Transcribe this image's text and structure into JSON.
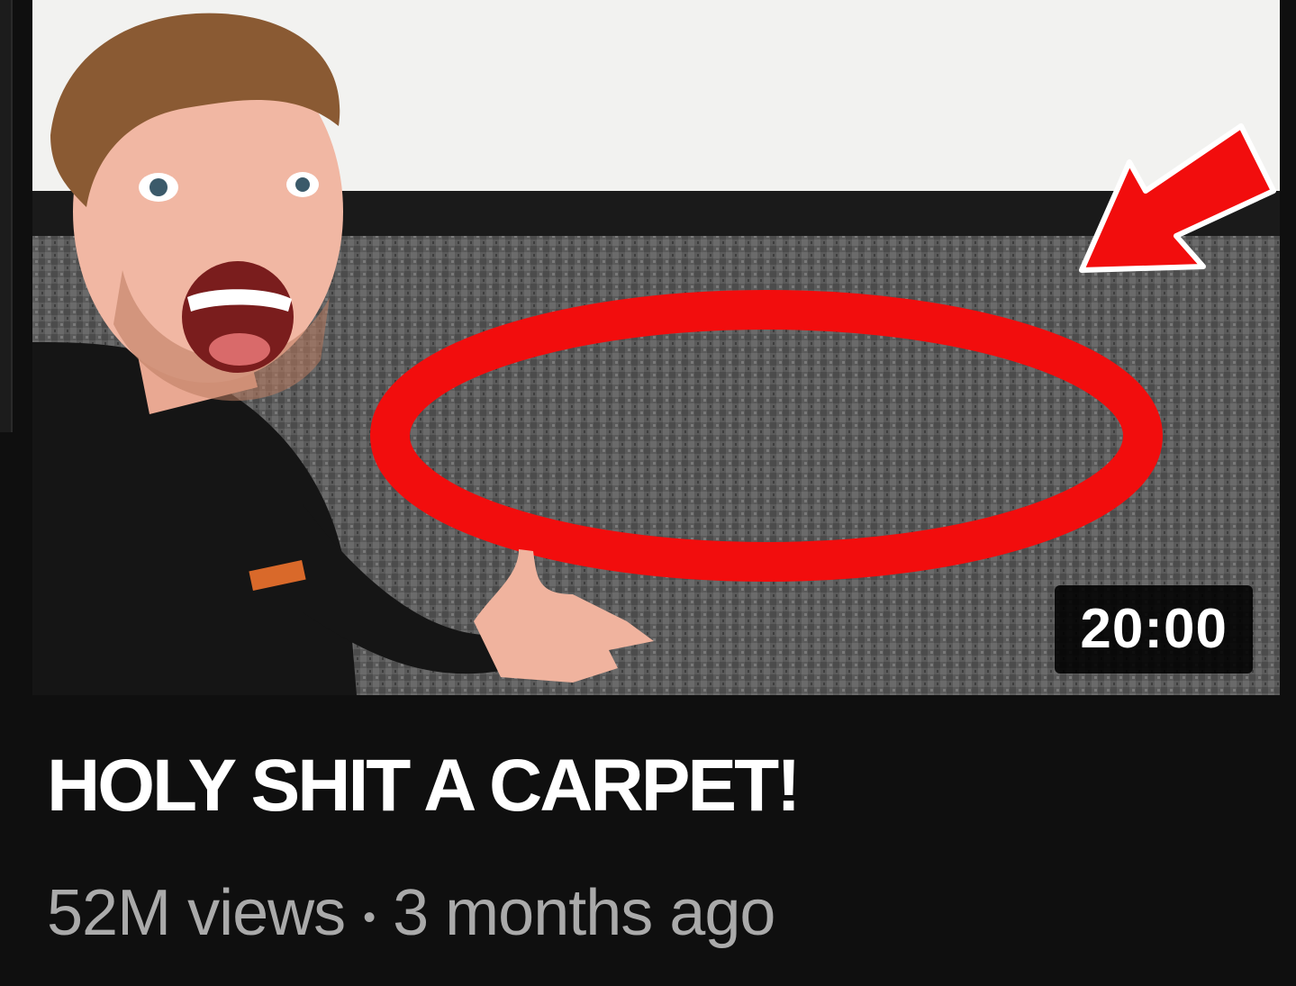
{
  "video": {
    "title": "HOLY SHIT A CARPET!",
    "duration": "20:00",
    "views": "52M views",
    "separator": "•",
    "age": "3 months ago"
  },
  "colors": {
    "background": "#0f0f0f",
    "title_text": "#ffffff",
    "meta_text": "#aaaaaa",
    "highlight_red": "#f20d0d",
    "carpet_gray": "#5a5a5a",
    "wall_white": "#f2f2f0"
  },
  "thumbnail": {
    "annotations": [
      "red-circle",
      "red-arrow"
    ]
  }
}
